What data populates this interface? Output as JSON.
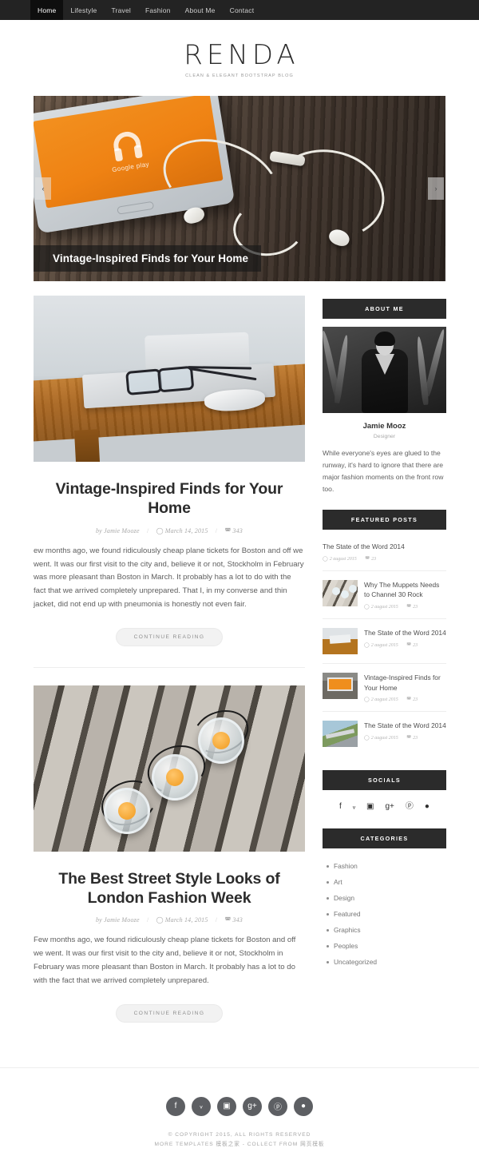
{
  "nav": {
    "items": [
      {
        "label": "Home",
        "active": true
      },
      {
        "label": "Lifestyle",
        "active": false
      },
      {
        "label": "Travel",
        "active": false
      },
      {
        "label": "Fashion",
        "active": false
      },
      {
        "label": "About Me",
        "active": false
      },
      {
        "label": "Contact",
        "active": false
      }
    ]
  },
  "brand": {
    "name": "RENDA",
    "tagline": "CLEAN & ELEGANT BOOTSTRAP BLOG"
  },
  "hero": {
    "caption": "Vintage-Inspired Finds for Your Home",
    "prev": "‹",
    "next": "›",
    "phone_label": "Google play"
  },
  "posts": [
    {
      "title": "Vintage-Inspired Finds for Your Home",
      "author": "by Jamie Mooze",
      "date": "March 14, 2015",
      "comments": "343",
      "excerpt": "ew months ago, we found ridiculously cheap plane tickets for Boston and off we went. It was our first visit to the city and, believe it or not, Stockholm in February was more pleasant than Boston in March. It probably has a lot to do with the fact that we arrived completely unprepared. That I, in my converse and thin jacket, did not end up with pneumonia is honestly not even fair.",
      "button": "CONTINUE READING"
    },
    {
      "title": "The Best Street Style Looks of London Fashion Week",
      "author": "by Jamie Mooze",
      "date": "March 14, 2015",
      "comments": "343",
      "excerpt": "Few months ago, we found ridiculously cheap plane tickets for Boston and off we went. It was our first visit to the city and, believe it or not, Stockholm in February was more pleasant than Boston in March. It probably has a lot to do with the fact that we arrived completely unprepared.",
      "button": "CONTINUE READING"
    }
  ],
  "sidebar": {
    "about": {
      "heading": "ABOUT ME",
      "name": "Jamie Mooz",
      "role": "Designer",
      "bio": "While everyone's eyes are glued to the runway, it's hard to ignore that there are major fashion moments on the front row too."
    },
    "featured": {
      "heading": "FEATURED POSTS",
      "items": [
        {
          "title": "The State of the Word 2014",
          "date": "2 august 2015",
          "comments": "23",
          "thumb": "none"
        },
        {
          "title": "Why The Muppets Needs to Channel 30 Rock",
          "date": "2 august 2015",
          "comments": "23",
          "thumb": "jars"
        },
        {
          "title": "The State of the Word 2014",
          "date": "2 august 2015",
          "comments": "23",
          "thumb": "desk"
        },
        {
          "title": "Vintage-Inspired Finds for Your Home",
          "date": "2 august 2015",
          "comments": "23",
          "thumb": "vintage"
        },
        {
          "title": "The State of the Word 2014",
          "date": "2 august 2015",
          "comments": "23",
          "thumb": "road"
        }
      ]
    },
    "socials": {
      "heading": "SOCIALS",
      "icons": [
        "facebook-icon",
        "twitter-icon",
        "instagram-icon",
        "google-plus-icon",
        "pinterest-icon",
        "dribbble-icon"
      ],
      "glyphs": [
        "f",
        "ᵥ",
        "▣",
        "g+",
        "ⓟ",
        "●"
      ]
    },
    "categories": {
      "heading": "CATEGORIES",
      "items": [
        "Fashion",
        "Art",
        "Design",
        "Featured",
        "Graphics",
        "Peoples",
        "Uncategorized"
      ]
    }
  },
  "footer": {
    "glyphs": [
      "f",
      "ᵥ",
      "▣",
      "g+",
      "ⓟ",
      "●"
    ],
    "icons": [
      "facebook-icon",
      "twitter-icon",
      "instagram-icon",
      "google-plus-icon",
      "pinterest-icon",
      "dribbble-icon"
    ],
    "copyright_line1": "© COPYRIGHT 2015, ALL RIGHTS RESERVED",
    "copyright_line2": "MORE TEMPLATES 模板之家 - COLLECT FROM 网页模板"
  },
  "colors": {
    "nav_bg": "#232323",
    "nav_active_bg": "#0e0e0e",
    "widget_head_bg": "#2b2b2b",
    "accent_orange": "#ef8e1d",
    "footer_circle": "#5d5f63"
  }
}
